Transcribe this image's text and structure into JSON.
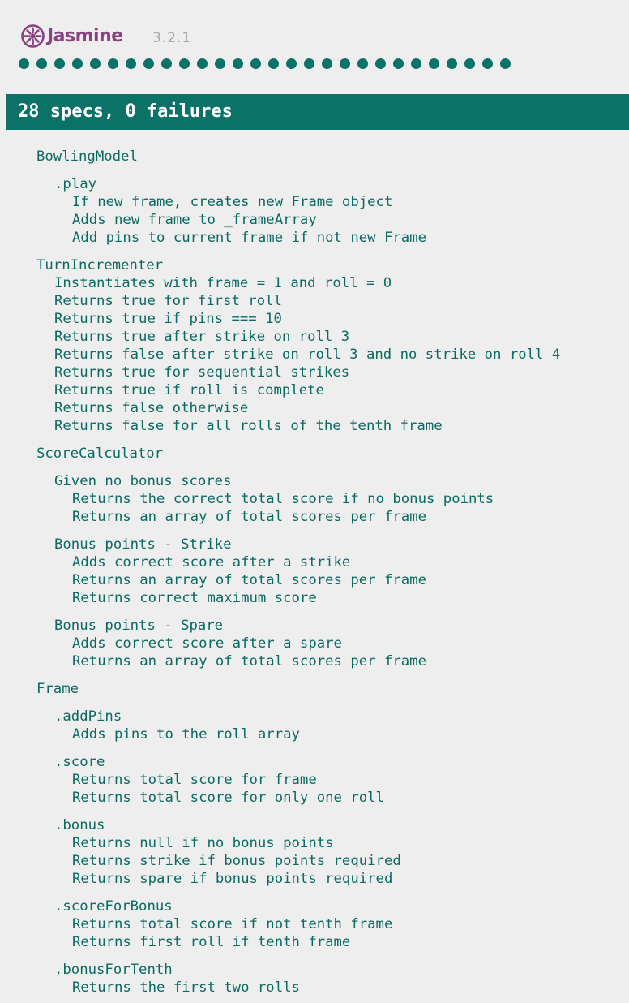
{
  "header": {
    "logo_text": "Jasmine",
    "version": "3.2.1",
    "spec_dot_count": 28,
    "spec_dot_color": "#0b7268",
    "logo_color": "#8a4182"
  },
  "summary": {
    "text": "28 specs, 0 failures",
    "bar_color": "#0b7268"
  },
  "suites": [
    {
      "name": "BowlingModel",
      "specs": [],
      "children": [
        {
          "name": ".play",
          "specs": [
            "If new frame, creates new Frame object",
            "Adds new frame to _frameArray",
            "Add pins to current frame if not new Frame"
          ]
        }
      ]
    },
    {
      "name": "TurnIncrementer",
      "specs": [
        "Instantiates with frame = 1 and roll = 0",
        "Returns true for first roll",
        "Returns true if pins === 10",
        "Returns true after strike on roll 3",
        "Returns false after strike on roll 3 and no strike on roll 4",
        "Returns true for sequential strikes",
        "Returns true if roll is complete",
        "Returns false otherwise",
        "Returns false for all rolls of the tenth frame"
      ],
      "children": []
    },
    {
      "name": "ScoreCalculator",
      "specs": [],
      "children": [
        {
          "name": "Given no bonus scores",
          "specs": [
            "Returns the correct total score if no bonus points",
            "Returns an array of total scores per frame"
          ]
        },
        {
          "name": "Bonus points - Strike",
          "specs": [
            "Adds correct score after a strike",
            "Returns an array of total scores per frame",
            "Returns correct maximum score"
          ]
        },
        {
          "name": "Bonus points - Spare",
          "specs": [
            "Adds correct score after a spare",
            "Returns an array of total scores per frame"
          ]
        }
      ]
    },
    {
      "name": "Frame",
      "specs": [],
      "children": [
        {
          "name": ".addPins",
          "specs": [
            "Adds pins to the roll array"
          ]
        },
        {
          "name": ".score",
          "specs": [
            "Returns total score for frame",
            "Returns total score for only one roll"
          ]
        },
        {
          "name": ".bonus",
          "specs": [
            "Returns null if no bonus points",
            "Returns strike if bonus points required",
            "Returns spare if bonus points required"
          ]
        },
        {
          "name": ".scoreForBonus",
          "specs": [
            "Returns total score if not tenth frame",
            "Returns first roll if tenth frame"
          ]
        },
        {
          "name": ".bonusForTenth",
          "specs": [
            "Returns the first two rolls"
          ]
        }
      ]
    }
  ]
}
